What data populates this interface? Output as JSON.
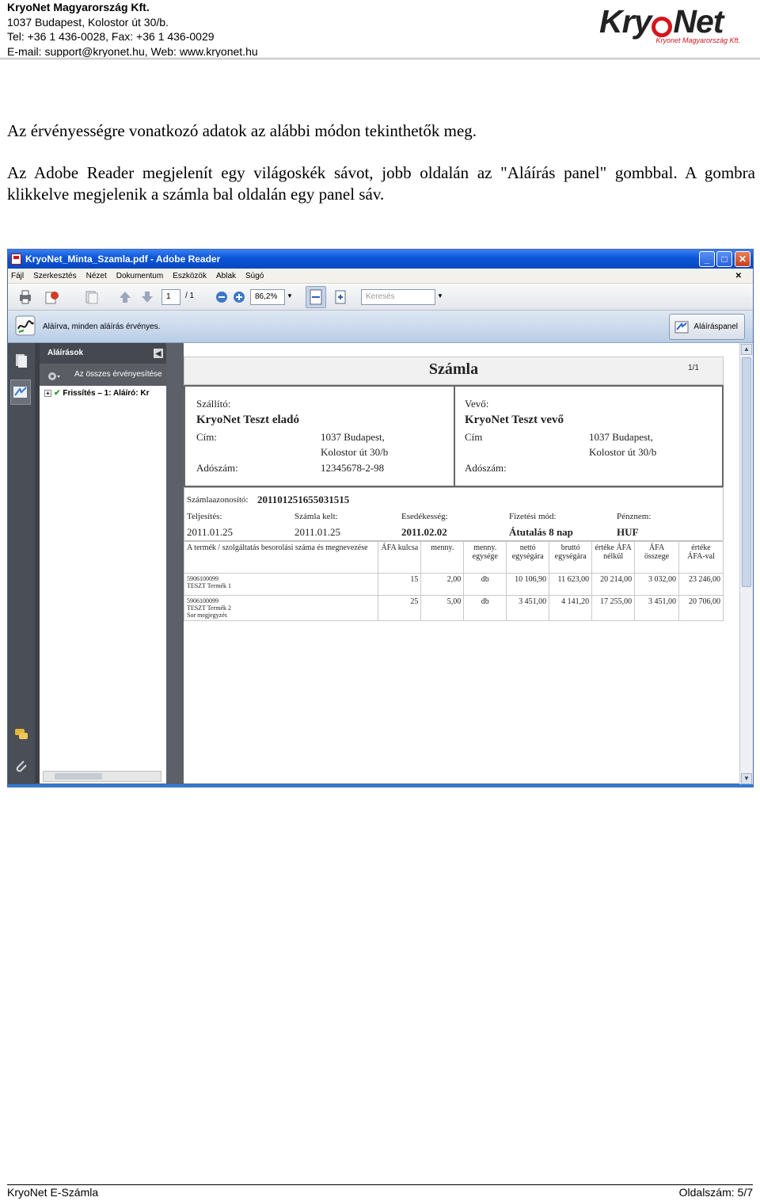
{
  "header": {
    "company": "KryoNet Magyarország Kft.",
    "address": "1037 Budapest, Kolostor út 30/b.",
    "phone": "Tel: +36 1 436-0028, Fax: +36 1 436-0029",
    "contact": "E-mail: support@kryonet.hu, Web: www.kryonet.hu",
    "logo": {
      "word_left": "Kry",
      "word_right": "Net",
      "tagline": "Kryonet Magyarország Kft.",
      "brand_red": "#d4151c"
    }
  },
  "body": {
    "para1": "Az érvényességre vonatkozó adatok az alábbi módon tekinthetők meg.",
    "para2": "Az Adobe Reader megjelenít egy világoskék sávot, jobb oldalán az \"Aláírás panel\" gombbal. A gombra klikkelve megjelenik a számla bal oldalán egy panel sáv."
  },
  "screenshot": {
    "window_title": "KryoNet_Minta_Szamla.pdf - Adobe Reader",
    "menu": [
      "Fájl",
      "Szerkesztés",
      "Nézet",
      "Dokumentum",
      "Eszközök",
      "Ablak",
      "Súgó"
    ],
    "page_current": "1",
    "page_total": "/ 1",
    "zoom": "86,2%",
    "search_placeholder": "Keresés",
    "signature_message": "Aláírva, minden aláírás érvényes.",
    "signature_panel_button": "Aláíráspanel",
    "panel_title": "Aláírások",
    "panel_toolbar": "Az összes érvényesítése",
    "panel_tree_item": "Frissítés – 1: Aláíró: Kr",
    "invoice": {
      "title": "Számla",
      "page": "1/1",
      "seller_label": "Szállító:",
      "seller_name": "KryoNet Teszt eladó",
      "seller_address_label": "Cím:",
      "seller_address_1": "1037 Budapest,",
      "seller_address_2": "Kolostor út 30/b",
      "seller_tax_label": "Adószám:",
      "seller_tax": "12345678-2-98",
      "buyer_label": "Vevő:",
      "buyer_name": "KryoNet Teszt vevő",
      "buyer_address_label": "Cím",
      "buyer_address_1": "1037 Budapest,",
      "buyer_address_2": "Kolostor út 30/b",
      "buyer_tax_label": "Adószám:",
      "id_label": "Számlaazonosító:",
      "id": "201101251655031515",
      "fulfil_label": "Teljesítés:",
      "fulfil": "2011.01.25",
      "issued_label": "Számla kelt:",
      "issued": "2011.01.25",
      "due_label": "Esedékesség:",
      "due": "2011.02.02",
      "payment_label": "Fizetési mód:",
      "payment": "Átutalás 8 nap",
      "currency_label": "Pénznem:",
      "currency": "HUF",
      "columns": [
        "A termék / szolgáltatás besorolási száma és megnevezése",
        "ÁFA kulcsa",
        "menny.",
        "menny. egysége",
        "nettó egységára",
        "bruttó egységára",
        "értéke ÁFA nélkül",
        "ÁFA összege",
        "értéke ÁFA-val"
      ],
      "rows": [
        {
          "code": "5906100099",
          "name": "TESZT Termék 1",
          "note": "",
          "vat": "15",
          "qty": "2,00",
          "unit": "db",
          "net_unit": "10 106,90",
          "gross_unit": "11 623,00",
          "net_total": "20 214,00",
          "vat_total": "3 032,00",
          "gross_total": "23 246,00"
        },
        {
          "code": "5906100099",
          "name": "TESZT Termék 2",
          "note": "Sor megjegyzés",
          "vat": "25",
          "qty": "5,00",
          "unit": "db",
          "net_unit": "3 451,00",
          "gross_unit": "4 141,20",
          "net_total": "17 255,00",
          "vat_total": "3 451,00",
          "gross_total": "20 706,00"
        }
      ]
    }
  },
  "footer": {
    "left": "KryoNet E-Számla",
    "right": "Oldalszám: 5/7"
  }
}
